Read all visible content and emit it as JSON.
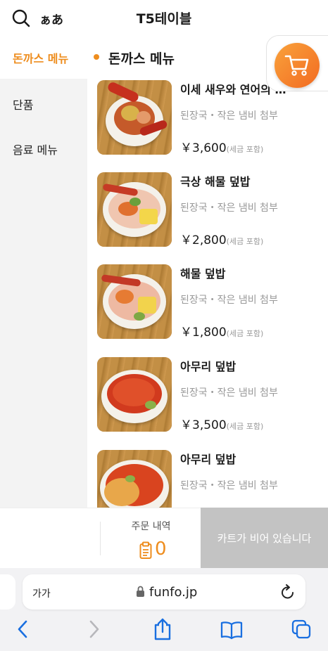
{
  "header": {
    "title": "T5테이블",
    "lang_label": "ぁあ"
  },
  "categories": {
    "active": "돈까스 메뉴",
    "items": [
      "단품",
      "음료 메뉴"
    ]
  },
  "section": {
    "title": "돈까스 메뉴"
  },
  "menu_items": [
    {
      "name": "이세 새우와 연어의 …",
      "desc": "된장국・작은 냄비 첨부",
      "price": "￥3,600",
      "tax": "(세금 포함)"
    },
    {
      "name": "극상 해물 덮밥",
      "desc": "된장국・작은 냄비 첨부",
      "price": "￥2,800",
      "tax": "(세금 포함)"
    },
    {
      "name": "해물 덮밥",
      "desc": "된장국・작은 냄비 첨부",
      "price": "￥1,800",
      "tax": "(세금 포함)"
    },
    {
      "name": "아무리 덮밥",
      "desc": "된장국・작은 냄비 첨부",
      "price": "￥3,500",
      "tax": "(세금 포함)"
    },
    {
      "name": "아무리 덮밥",
      "desc": "된장국・작은 냄비 첨부",
      "price": "",
      "tax": ""
    }
  ],
  "order_bar": {
    "history_label": "주문 내역",
    "history_count": "0",
    "cart_status": "카트가 비어 있습니다"
  },
  "browser": {
    "aa_label": "가가",
    "url": "funfo.jp"
  },
  "colors": {
    "accent": "#ee8d1e",
    "cart_gradient_start": "#f9a23b",
    "cart_gradient_end": "#f26b22",
    "disabled": "#c3c3c3",
    "browser_blue": "#1a6fe0"
  },
  "icons": {
    "search": "search-icon",
    "cart": "cart-icon",
    "receipt": "receipt-icon",
    "lock": "lock-icon",
    "reload": "reload-icon",
    "back": "back-chevron-icon",
    "forward": "forward-chevron-icon",
    "share": "share-icon",
    "bookmarks": "book-icon",
    "tabs": "tabs-icon"
  }
}
